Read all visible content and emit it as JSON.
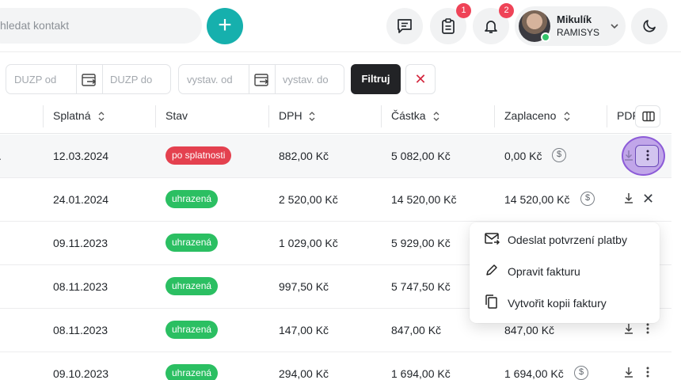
{
  "topbar": {
    "search_placeholder": "hledat kontakt",
    "add_label": "+",
    "messages_icon": "chat-icon",
    "tasks_badge": "1",
    "notifications_badge": "2",
    "user_name": "Mikulík",
    "user_company": "RAMISYS",
    "theme_icon": "moon-icon"
  },
  "filters": {
    "duzp_from": "DUZP od",
    "duzp_to": "DUZP do",
    "issued_from": "vystav. od",
    "issued_to": "vystav. do",
    "filter_button": "Filtruj",
    "clear_button": "✕"
  },
  "table": {
    "headers": [
      "Splatná",
      "Stav",
      "DPH",
      "Částka",
      "Zaplaceno",
      "PDF"
    ],
    "rows": [
      {
        "due": "12.03.2024",
        "status": "po splatnosti",
        "vat": "882,00 Kč",
        "amount": "5 082,00 Kč",
        "paid": "0,00 Kč"
      },
      {
        "due": "24.01.2024",
        "status": "uhrazená",
        "vat": "2 520,00 Kč",
        "amount": "14 520,00 Kč",
        "paid": "14 520,00 Kč"
      },
      {
        "due": "09.11.2023",
        "status": "uhrazená",
        "vat": "1 029,00 Kč",
        "amount": "5 929,00 Kč",
        "paid": ""
      },
      {
        "due": "08.11.2023",
        "status": "uhrazená",
        "vat": "997,50 Kč",
        "amount": "5 747,50 Kč",
        "paid": ""
      },
      {
        "due": "08.11.2023",
        "status": "uhrazená",
        "vat": "147,00 Kč",
        "amount": "847,00 Kč",
        "paid": "847,00 Kč"
      },
      {
        "due": "09.10.2023",
        "status": "uhrazená",
        "vat": "294,00 Kč",
        "amount": "1 694,00 Kč",
        "paid": "1 694,00 Kč"
      }
    ]
  },
  "context_menu": {
    "items": [
      {
        "label": "Odeslat potvrzení platby",
        "icon": "mail-send-icon"
      },
      {
        "label": "Opravit fakturu",
        "icon": "pencil-icon"
      },
      {
        "label": "Vytvořit kopii faktury",
        "icon": "copy-icon"
      }
    ]
  },
  "colors": {
    "accent": "#16b0ad",
    "overdue": "#e4414f",
    "paid": "#2bbf62",
    "badge": "#ef4357"
  }
}
